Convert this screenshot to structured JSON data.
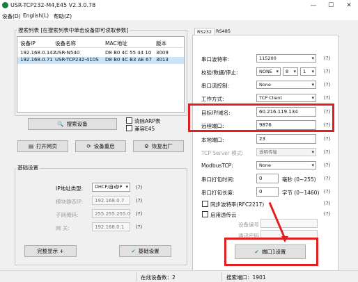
{
  "app": {
    "title": "USR-TCP232-M4,E45 V2.3.0.78"
  },
  "window": {
    "minimize": "—",
    "maximize": "☐",
    "close": "✕"
  },
  "menu": {
    "items": [
      "设备(D)",
      "English(L)",
      "帮助(Z)"
    ]
  },
  "search_list": {
    "title": "搜索列表 [在搜索列表中单击设备即可读取参数]",
    "columns": [
      "设备IP",
      "设备名称",
      "MAC地址",
      "版本"
    ],
    "rows": [
      {
        "ip": "192.168.0.142",
        "name": "USR-N540",
        "mac": "D8 B0 4C 55 44 10",
        "version": "3009"
      },
      {
        "ip": "192.168.0.71",
        "name": "USR-TCP232-410S",
        "mac": "D8 B0 4C B3 AE 67",
        "version": "3013"
      }
    ]
  },
  "actions": {
    "search": "搜索设备",
    "clear_arp": "清除ARP表",
    "compat_e45": "兼容E45",
    "open_web": "打开网页",
    "restart": "设备重启",
    "factory_reset": "恢复出厂"
  },
  "basic": {
    "title": "基础设置",
    "ip_type_label": "IP地址类型:",
    "ip_type_value": "DHCP/自动IP",
    "module_ip_label": "模块静态IP:",
    "module_ip_value": "192.168.0.7",
    "subnet_label": "子网掩码:",
    "subnet_value": "255.255.255.0",
    "gateway_label": "网   关:",
    "gateway_value": "192.168.0.1",
    "q": "(?)",
    "show_all": "完整显示 +",
    "save": "基础设置"
  },
  "tabs": [
    "RS232",
    "RS485"
  ],
  "port": {
    "baud_label": "串口波特率:",
    "baud_value": "115200",
    "param_label": "校验/数据/停止:",
    "parity": "NONE",
    "data_bits": "8",
    "stop_bits": "1",
    "flow_label": "串口流控制:",
    "flow_value": "None",
    "mode_label": "工作方式:",
    "mode_value": "TCP Client",
    "target_label": "目标IP/域名:",
    "target_value": "60.216.119.134",
    "remote_port_label": "远程端口:",
    "remote_port_value": "9876",
    "local_port_label": "本地端口:",
    "local_port_value": "23",
    "tcp_mode_label": "TCP Server 模式:",
    "tcp_mode_value": "透明传输",
    "modbus_label": "ModbusTCP:",
    "modbus_value": "None",
    "pack_time_label": "串口打包时间:",
    "pack_time_value": "0",
    "pack_time_unit": "毫秒 (0~255)",
    "pack_len_label": "串口打包长度:",
    "pack_len_value": "0",
    "pack_len_unit": "字节 (0~1460)",
    "sync_baud": "同步波特率(RFC2217)",
    "register_pkg": "启用透传云",
    "device_id_label": "设备编号",
    "comm_pwd_label": "通讯密码",
    "q": "(?)",
    "save": "端口1设置"
  },
  "status": {
    "online": "在线设备数：2",
    "search_port": "搜索端口：1901"
  },
  "colors": {
    "highlight": "#e02020",
    "check": "#2ea043"
  }
}
